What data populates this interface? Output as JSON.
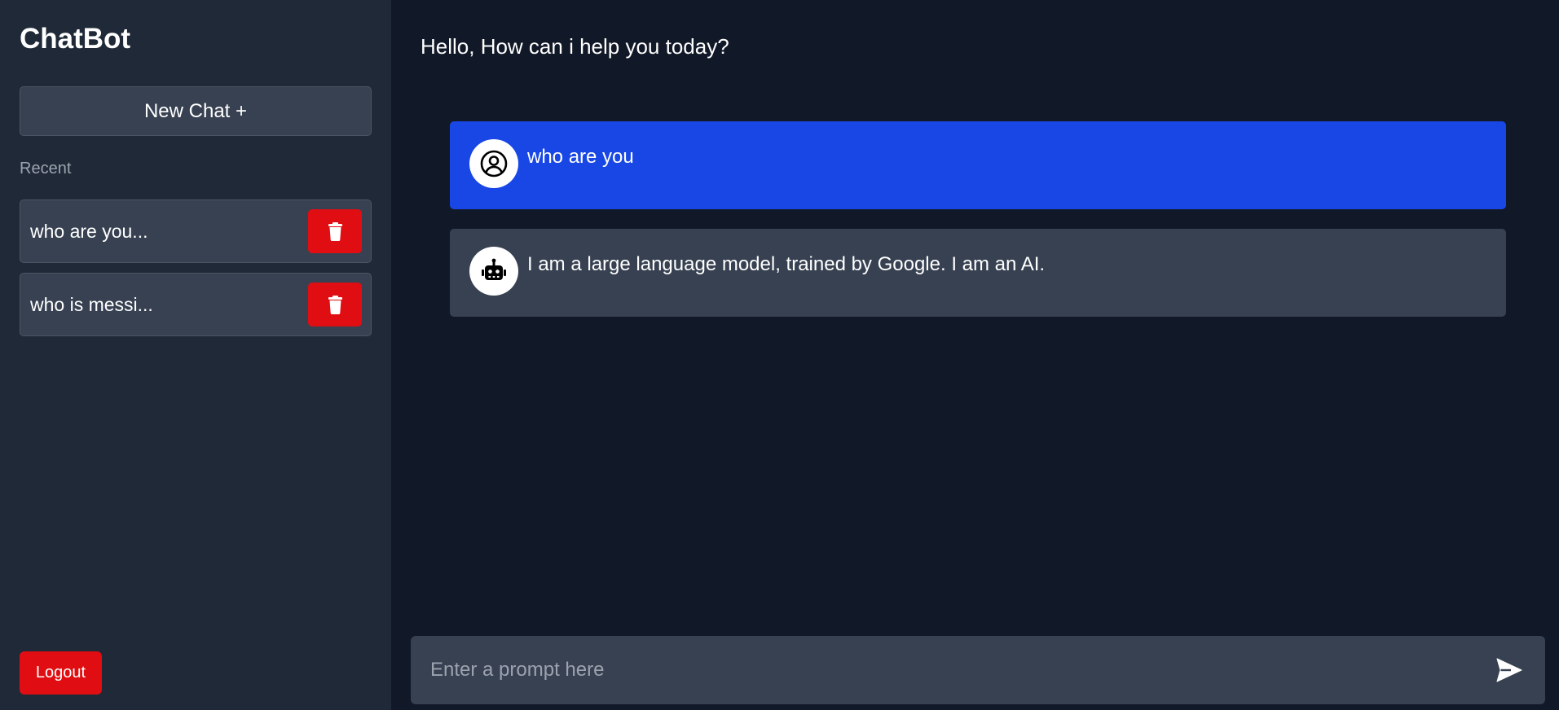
{
  "sidebar": {
    "app_title": "ChatBot",
    "new_chat_label": "New Chat +",
    "recent_label": "Recent",
    "history": [
      {
        "label": "who are you..."
      },
      {
        "label": "who is messi..."
      }
    ],
    "logout_label": "Logout"
  },
  "main": {
    "greeting": "Hello, How can i help you today?",
    "messages": [
      {
        "role": "user",
        "icon": "user-circle-icon",
        "text": "who are you"
      },
      {
        "role": "bot",
        "icon": "robot-icon",
        "text": "I am a large language model, trained by Google. I am an AI."
      }
    ],
    "prompt_placeholder": "Enter a prompt here",
    "send_icon": "send-icon"
  },
  "colors": {
    "sidebar_bg": "#1f2937",
    "main_bg": "#111827",
    "card_bg": "#374151",
    "user_message_bg": "#1947e5",
    "danger": "#e00e12",
    "muted_text": "#9ca3af"
  }
}
